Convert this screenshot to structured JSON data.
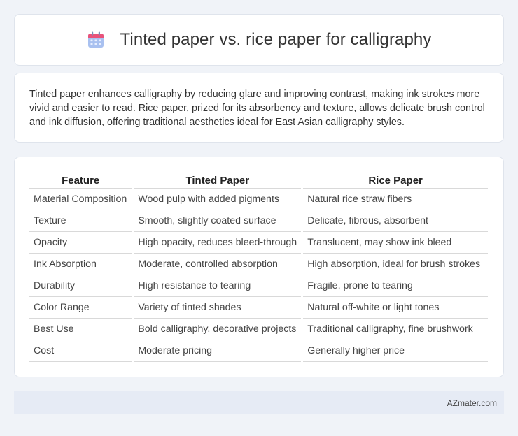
{
  "header": {
    "title": "Tinted paper vs. rice paper for calligraphy",
    "icon": "calendar-icon"
  },
  "intro": {
    "text": "Tinted paper enhances calligraphy by reducing glare and improving contrast, making ink strokes more vivid and easier to read. Rice paper, prized for its absorbency and texture, allows delicate brush control and ink diffusion, offering traditional aesthetics ideal for East Asian calligraphy styles."
  },
  "table": {
    "headers": [
      "Feature",
      "Tinted Paper",
      "Rice Paper"
    ],
    "rows": [
      [
        "Material Composition",
        "Wood pulp with added pigments",
        "Natural rice straw fibers"
      ],
      [
        "Texture",
        "Smooth, slightly coated surface",
        "Delicate, fibrous, absorbent"
      ],
      [
        "Opacity",
        "High opacity, reduces bleed-through",
        "Translucent, may show ink bleed"
      ],
      [
        "Ink Absorption",
        "Moderate, controlled absorption",
        "High absorption, ideal for brush strokes"
      ],
      [
        "Durability",
        "High resistance to tearing",
        "Fragile, prone to tearing"
      ],
      [
        "Color Range",
        "Variety of tinted shades",
        "Natural off-white or light tones"
      ],
      [
        "Best Use",
        "Bold calligraphy, decorative projects",
        "Traditional calligraphy, fine brushwork"
      ],
      [
        "Cost",
        "Moderate pricing",
        "Generally higher price"
      ]
    ]
  },
  "footer": {
    "brand": "AZmater.com"
  },
  "colors": {
    "background": "#f0f3f8",
    "card": "#ffffff",
    "footer": "#e6ebf5",
    "icon_top": "#e9527a",
    "icon_body": "#8fb0ea"
  }
}
